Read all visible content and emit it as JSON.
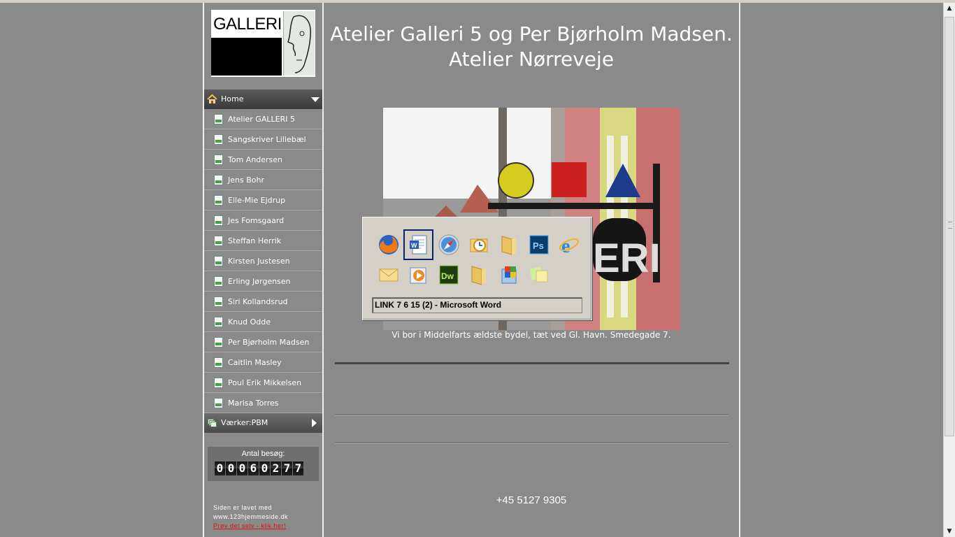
{
  "site": {
    "title_line1": "Atelier Galleri 5 og Per Bjørholm Madsen.",
    "title_line2": "Atelier Nørreveje",
    "logo_text": "GALLERI 5"
  },
  "nav": {
    "home_label": "Home",
    "items": [
      {
        "label": "Atelier GALLERI 5"
      },
      {
        "label": "Sangskriver Lillebæl"
      },
      {
        "label": "Tom Andersen"
      },
      {
        "label": "Jens Bohr"
      },
      {
        "label": "Elle-Mie Ejdrup"
      },
      {
        "label": "Jes Fomsgaard"
      },
      {
        "label": "Steffan Herrik"
      },
      {
        "label": "Kirsten Justesen"
      },
      {
        "label": "Erling Jørgensen"
      },
      {
        "label": "Siri Kollandsrud"
      },
      {
        "label": "Knud Odde"
      },
      {
        "label": "Per Bjørholm Madsen"
      },
      {
        "label": "Caitlin Masley"
      },
      {
        "label": "Poul Erik Mikkelsen"
      },
      {
        "label": "Marisa Torres"
      }
    ],
    "works_label": "Værker:PBM"
  },
  "counter": {
    "label": "Antal besøg:",
    "digits": [
      "0",
      "0",
      "0",
      "6",
      "0",
      "2",
      "7",
      "7"
    ]
  },
  "footer": {
    "made_line1": "Siden er lavet med",
    "made_line2": "www.123hjemmeside.dk",
    "try_link": "Prøv det selv - klik her!"
  },
  "main": {
    "caption": "Vi bor i Middelfarts ældste bydel, tæt ved Gl. Havn. Smedegade 7.",
    "sign_text": "ERI",
    "phone": "+45 5127 9305"
  },
  "alt_tab": {
    "icons": [
      "firefox-icon",
      "word-document-icon",
      "safari-icon",
      "outlook-icon",
      "folder-icon",
      "photoshop-icon",
      "internet-explorer-icon",
      "mail-icon",
      "media-player-icon",
      "dreamweaver-icon",
      "folder-icon",
      "windows-explorer-icon",
      "sticky-notes-icon"
    ],
    "selected_index": 1,
    "window_title": "LINK  7 6 15 (2) - Microsoft Word"
  },
  "colors": {
    "page_bg": "#8a8a8a",
    "nav_head": "#3a3a3a",
    "link_red": "#e01010"
  }
}
